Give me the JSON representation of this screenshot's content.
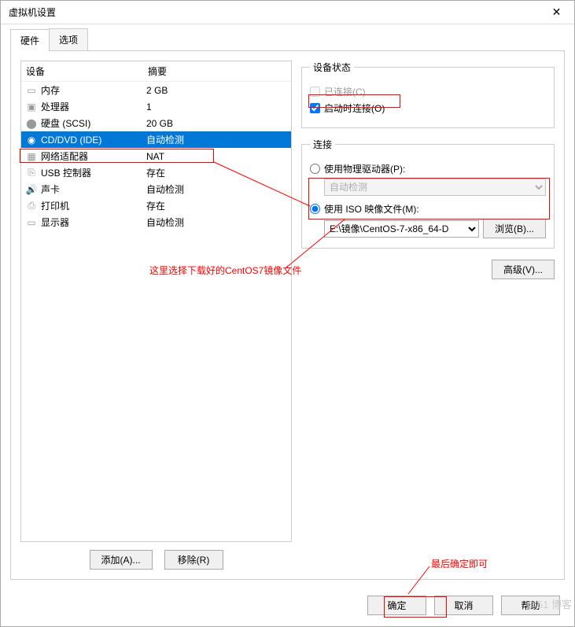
{
  "window": {
    "title": "虚拟机设置"
  },
  "tabs": {
    "hardware": "硬件",
    "options": "选项"
  },
  "columns": {
    "device": "设备",
    "summary": "摘要"
  },
  "devices": [
    {
      "icon": "memory",
      "name": "内存",
      "summary": "2 GB"
    },
    {
      "icon": "cpu",
      "name": "处理器",
      "summary": "1"
    },
    {
      "icon": "disk",
      "name": "硬盘 (SCSI)",
      "summary": "20 GB"
    },
    {
      "icon": "cd",
      "name": "CD/DVD (IDE)",
      "summary": "自动检测",
      "selected": true
    },
    {
      "icon": "nic",
      "name": "网络适配器",
      "summary": "NAT"
    },
    {
      "icon": "usb",
      "name": "USB 控制器",
      "summary": "存在"
    },
    {
      "icon": "sound",
      "name": "声卡",
      "summary": "自动检测"
    },
    {
      "icon": "printer",
      "name": "打印机",
      "summary": "存在"
    },
    {
      "icon": "display",
      "name": "显示器",
      "summary": "自动检测"
    }
  ],
  "leftButtons": {
    "add": "添加(A)...",
    "remove": "移除(R)"
  },
  "deviceStatus": {
    "legend": "设备状态",
    "connected": "已连接(C)",
    "connectAtPowerOn": "启动时连接(O)"
  },
  "connection": {
    "legend": "连接",
    "usePhysical": "使用物理驱动器(P):",
    "autoDetect": "自动检测",
    "useIso": "使用 ISO 映像文件(M):",
    "isoPath": "E:\\镜像\\CentOS-7-x86_64-D",
    "browse": "浏览(B)..."
  },
  "advanced": "高级(V)...",
  "bottom": {
    "ok": "确定",
    "cancel": "取消",
    "help": "帮助"
  },
  "annotations": {
    "text1": "这里选择下载好的CentOS7镜像文件",
    "text2": "最后确定即可"
  },
  "watermark": "@51        博客"
}
